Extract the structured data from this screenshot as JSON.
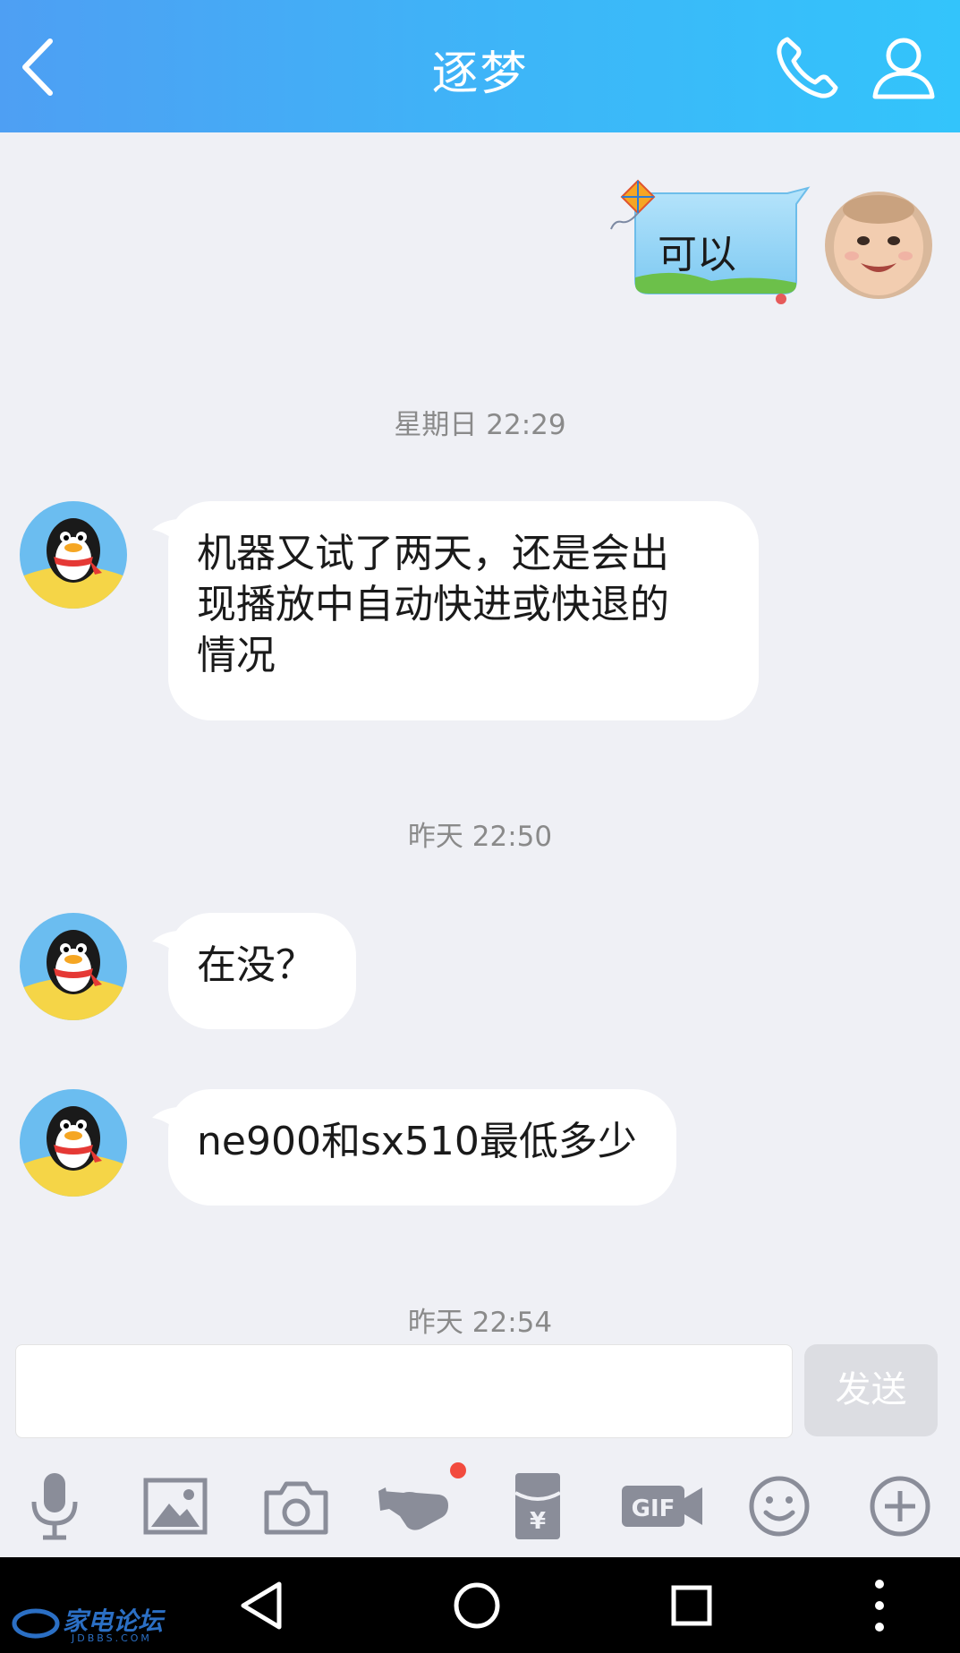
{
  "header": {
    "title": "逐梦"
  },
  "messages": [
    {
      "side": "right",
      "text": "可以"
    },
    {
      "timestamp": "星期日 22:29"
    },
    {
      "side": "left",
      "lines": [
        "机器又试了两天，还是会出",
        "现播放中自动快进或快退的",
        "情况"
      ]
    },
    {
      "timestamp": "昨天 22:50"
    },
    {
      "side": "left",
      "text": "在没？"
    },
    {
      "side": "left",
      "text": "ne900和sx510最低多少"
    },
    {
      "timestamp": "昨天 22:54"
    }
  ],
  "input": {
    "value": "",
    "send_label": "发送"
  },
  "toolbar": {
    "icons": [
      "microphone-icon",
      "image-icon",
      "camera-icon",
      "poke-hand-icon",
      "red-packet-icon",
      "gif-video-icon",
      "emoji-icon",
      "plus-circle-icon"
    ]
  },
  "watermark": {
    "name": "家电论坛",
    "url": "JDBBS.COM"
  },
  "colors": {
    "header_gradient_start": "#4e9ff3",
    "header_gradient_end": "#33c4fb",
    "background": "#eff0f5",
    "bubble": "#ffffff",
    "icon_gray": "#8a8d99",
    "notify_dot": "#f24b3e"
  }
}
